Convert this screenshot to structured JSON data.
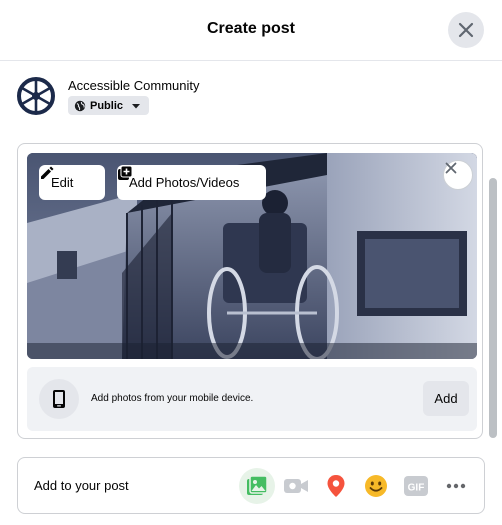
{
  "dialog": {
    "title": "Create post"
  },
  "author": {
    "name": "Accessible Community",
    "privacy": "Public"
  },
  "media": {
    "edit_label": "Edit",
    "add_media_label": "Add Photos/Videos",
    "mobile_text": "Add photos from your mobile device.",
    "mobile_add_label": "Add"
  },
  "add_to_post": {
    "label": "Add to your post",
    "tools": [
      {
        "icon": "photo-video-icon",
        "color": "#45bd62",
        "state": "active"
      },
      {
        "icon": "live-video-icon",
        "color": "#c8cbd0",
        "state": "disabled"
      },
      {
        "icon": "location-pin-icon",
        "color": "#f5533d",
        "state": "enabled"
      },
      {
        "icon": "feeling-emoji-icon",
        "color": "#f7b928",
        "state": "enabled"
      },
      {
        "icon": "gif-icon",
        "color": "#c8cbd0",
        "gif_text": "GIF",
        "state": "disabled"
      },
      {
        "icon": "more-icon",
        "color": "#65676b",
        "state": "enabled"
      }
    ]
  },
  "colors": {
    "primary_text": "#050505",
    "button_bg": "#e4e6eb",
    "border": "#ced0d4",
    "brand_navy": "#1c2a4a"
  }
}
